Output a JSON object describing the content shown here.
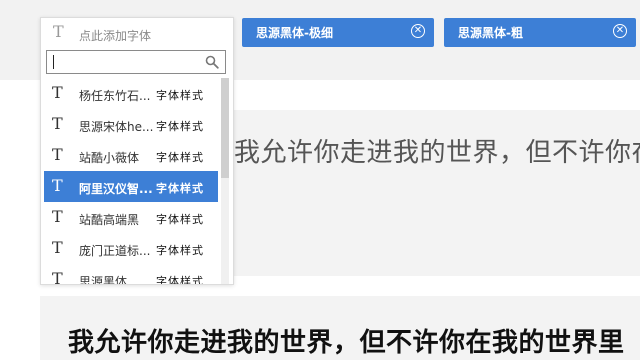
{
  "selected_fonts": [
    {
      "label": "思源黑体-极细",
      "close_icon": "close-circle-icon"
    },
    {
      "label": "思源黑体-粗",
      "close_icon": "close-circle-icon"
    }
  ],
  "picker": {
    "placeholder": "点此添加字体",
    "search_value": "",
    "items": [
      {
        "name": "杨任东竹石...",
        "sample": "字体样式"
      },
      {
        "name": "思源宋体he...",
        "sample": "字体样式"
      },
      {
        "name": "站酷小薇体",
        "sample": "字体样式"
      },
      {
        "name": "阿里汉仪智...",
        "sample": "字体样式"
      },
      {
        "name": "站酷高端黑",
        "sample": "字体样式"
      },
      {
        "name": "庞门正道标...",
        "sample": "字体样式"
      },
      {
        "name": "思源黑体...",
        "sample": "字体样式"
      }
    ],
    "selected_index": 3
  },
  "previews": [
    {
      "text": "我允许你走进我的世界，但不许你在我的世界里"
    },
    {
      "text": "我允许你走进我的世界，但不许你在我的世界里"
    }
  ],
  "icons": {
    "font_item": "font-T-icon",
    "search": "search-icon"
  },
  "colors": {
    "accent": "#3d7fd6",
    "preview_bg": "#f3f3f3"
  }
}
